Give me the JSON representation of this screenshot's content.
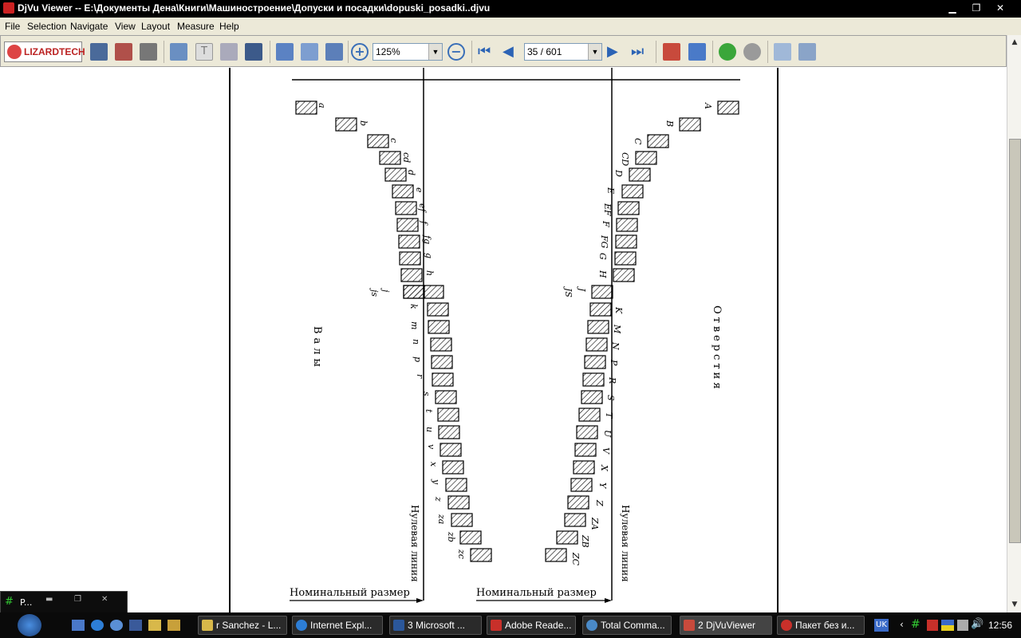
{
  "window": {
    "title": "DjVu Viewer -- E:\\Документы Дена\\Книги\\Машиностроение\\Допуски и посадки\\dopuski_posadki..djvu",
    "min": "▁",
    "max": "❐",
    "close": "✕"
  },
  "menu": [
    "File",
    "Selection",
    "Navigate",
    "View",
    "Layout",
    "Measure",
    "Help"
  ],
  "toolbar": {
    "logo": "LIZARDTECH",
    "zoom": "125%",
    "page": "35 / 601"
  },
  "doc": {
    "shaft_letters": [
      "a",
      "b",
      "c",
      "cd",
      "d",
      "e",
      "ef",
      "f",
      "fg",
      "g",
      "h",
      "j",
      "js",
      "k",
      "m",
      "n",
      "p",
      "r",
      "s",
      "t",
      "u",
      "v",
      "x",
      "y",
      "z",
      "za",
      "zb",
      "zc"
    ],
    "hole_letters": [
      "A",
      "B",
      "C",
      "CD",
      "D",
      "E",
      "EF",
      "F",
      "FG",
      "G",
      "H",
      "J",
      "JS",
      "K",
      "M",
      "N",
      "P",
      "R",
      "S",
      "T",
      "U",
      "V",
      "X",
      "Y",
      "Z",
      "ZA",
      "ZB",
      "ZC"
    ],
    "shafts_label": "Валы",
    "holes_label": "Отверстия",
    "zero_line": "Нулевая линия",
    "nominal": "Номинальный размер"
  },
  "taskbar": {
    "float_title": "P...",
    "items": [
      "r Sanchez - L...",
      "Internet Expl...",
      "3 Microsoft ...",
      "Adobe Reade...",
      "Total Comma...",
      "2 DjVuViewer",
      "Пакет без и..."
    ],
    "lang": "UK",
    "clock": "12:56"
  },
  "colors": {
    "titlebar": "#000000",
    "chrome": "#ece9d8",
    "taskbar": "#0a0a0a",
    "hatch": "#000000"
  }
}
